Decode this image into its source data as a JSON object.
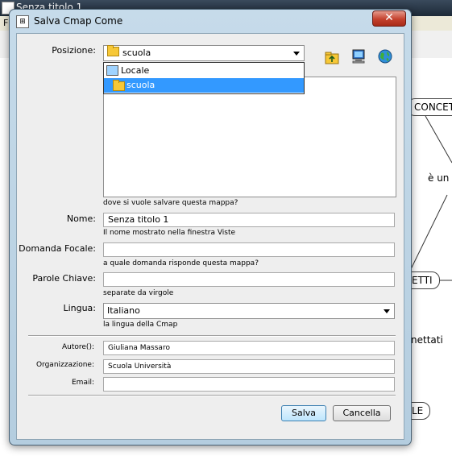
{
  "background_app": {
    "window_title": "Senza titolo 1",
    "menu_first_letter": "F",
    "nodes": {
      "concetti_top": "CONCETTU",
      "concetti_mid": "ETTI",
      "bottom_node": "LE"
    },
    "link_labels": {
      "e_un": "è un",
      "collegati": "nettati"
    }
  },
  "dialog": {
    "title": "Salva Cmap Come",
    "close_symbol": "✕",
    "position": {
      "label": "Posizione:",
      "selected": "scuola",
      "options": [
        "Locale",
        "scuola"
      ],
      "hint": "dove si vuole salvare questa mappa?"
    },
    "name": {
      "label": "Nome:",
      "value": "Senza titolo 1",
      "hint": "Il nome mostrato nella finestra Viste"
    },
    "focus_question": {
      "label": "Domanda Focale:",
      "value": "",
      "hint": "a quale domanda risponde questa mappa?"
    },
    "keywords": {
      "label": "Parole Chiave:",
      "value": "",
      "hint": "separate da virgole"
    },
    "language": {
      "label": "Lingua:",
      "selected": "Italiano",
      "hint": "la lingua della Cmap"
    },
    "author": {
      "label": "Autore():",
      "value": "Giuliana Massaro"
    },
    "organization": {
      "label": "Organizzazione:",
      "value": "Scuola Università"
    },
    "email": {
      "label": "Email:",
      "value": ""
    },
    "buttons": {
      "save": "Salva",
      "cancel": "Cancella"
    },
    "toolbar_icons": [
      "folder-up-icon",
      "computer-icon",
      "globe-icon"
    ]
  }
}
